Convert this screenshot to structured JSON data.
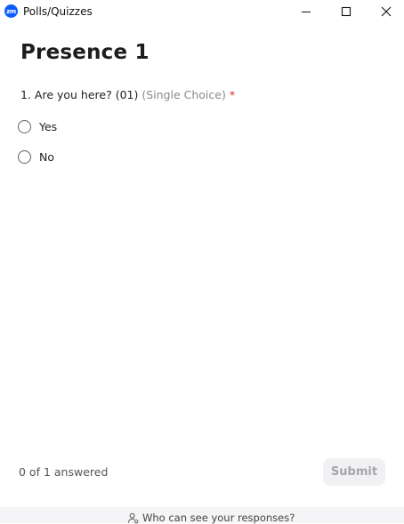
{
  "window": {
    "app_logo_text": "zm",
    "title": "Polls/Quizzes",
    "logo_color": "#0b5cff"
  },
  "poll": {
    "title": "Presence 1",
    "question": {
      "text": "1. Are you here? (01)",
      "type": "(Single Choice)",
      "required_mark": "*",
      "options": [
        {
          "label": "Yes",
          "selected": false
        },
        {
          "label": "No",
          "selected": false
        }
      ]
    }
  },
  "footer": {
    "answered_text": "0 of 1 answered",
    "submit_label": "Submit",
    "submit_enabled": false,
    "privacy_link": "Who can see your responses?"
  },
  "icons": {
    "minimize": "minimize-icon",
    "maximize": "maximize-icon",
    "close": "close-icon",
    "privacy": "person-icon"
  },
  "colors": {
    "required": "#e02828",
    "submit_disabled_bg": "#f1f1f3",
    "submit_disabled_text": "#a6a6aa"
  }
}
